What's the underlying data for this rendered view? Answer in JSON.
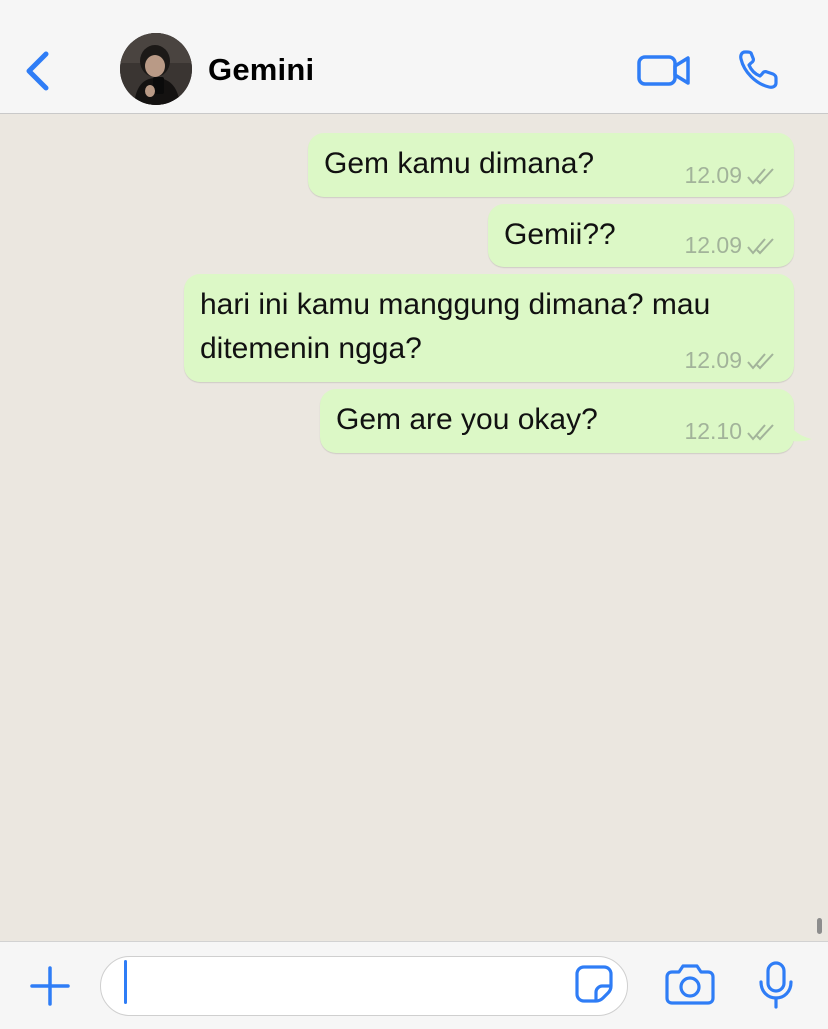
{
  "header": {
    "contact_name": "Gemini"
  },
  "messages": [
    {
      "text": "Gem kamu dimana?",
      "time": "12.09",
      "status": "read"
    },
    {
      "text": "Gemii??",
      "time": "12.09",
      "status": "read"
    },
    {
      "text_line1": "hari ini kamu manggung dimana? mau",
      "text_line2": "ditemenin ngga?",
      "time": "12.09",
      "status": "read"
    },
    {
      "text": "Gem are you okay?",
      "time": "12.10",
      "status": "read"
    }
  ],
  "input": {
    "value": "",
    "placeholder": ""
  },
  "icons": {
    "back": "chevron-left-icon",
    "video": "video-camera-icon",
    "call": "phone-icon",
    "add": "plus-icon",
    "sticker": "sticker-icon",
    "camera": "camera-icon",
    "mic": "microphone-icon"
  },
  "colors": {
    "accent": "#2f7df6",
    "outgoing_bubble": "#dcf8c6",
    "chat_background": "#ebe7e0",
    "header_background": "#f6f6f6",
    "timestamp": "#a2b39a"
  }
}
